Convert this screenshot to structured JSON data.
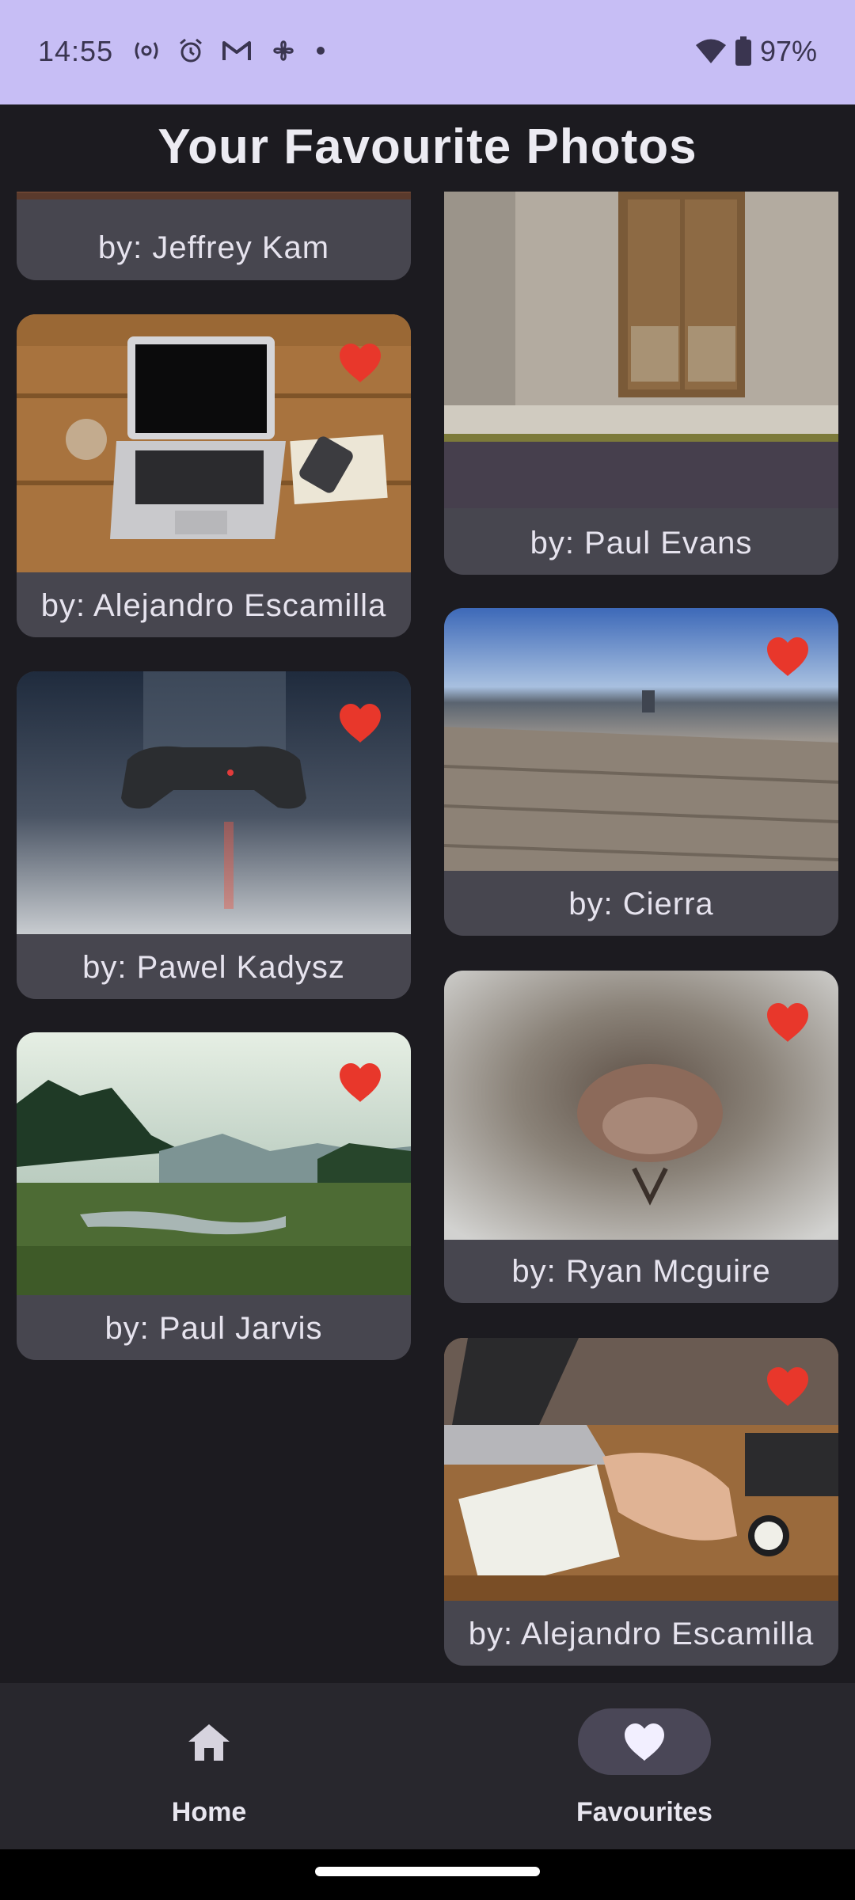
{
  "status_bar": {
    "time": "14:55",
    "battery": "97%",
    "icons": [
      "radio-icon",
      "alarm-icon",
      "gmail-icon",
      "pinwheel-icon",
      "dot-icon",
      "wifi-icon",
      "battery-icon"
    ],
    "background": "#c7bef5"
  },
  "page": {
    "title": "Your Favourite Photos"
  },
  "photos": [
    {
      "author": "by: Jeffrey Kam",
      "favourited": true
    },
    {
      "author": "by: Alejandro Escamilla",
      "favourited": true
    },
    {
      "author": "by: Pawel Kadysz",
      "favourited": true
    },
    {
      "author": "by: Paul Jarvis",
      "favourited": true
    },
    {
      "author": "by: Paul Evans",
      "favourited": true
    },
    {
      "author": "by: Cierra",
      "favourited": true
    },
    {
      "author": "by: Ryan Mcguire",
      "favourited": true
    },
    {
      "author": "by: Alejandro Escamilla",
      "favourited": true
    }
  ],
  "nav": {
    "home_label": "Home",
    "favourites_label": "Favourites",
    "active": "favourites"
  },
  "colors": {
    "heart": "#e8372b",
    "card": "#47464f",
    "background": "#1c1b20"
  }
}
